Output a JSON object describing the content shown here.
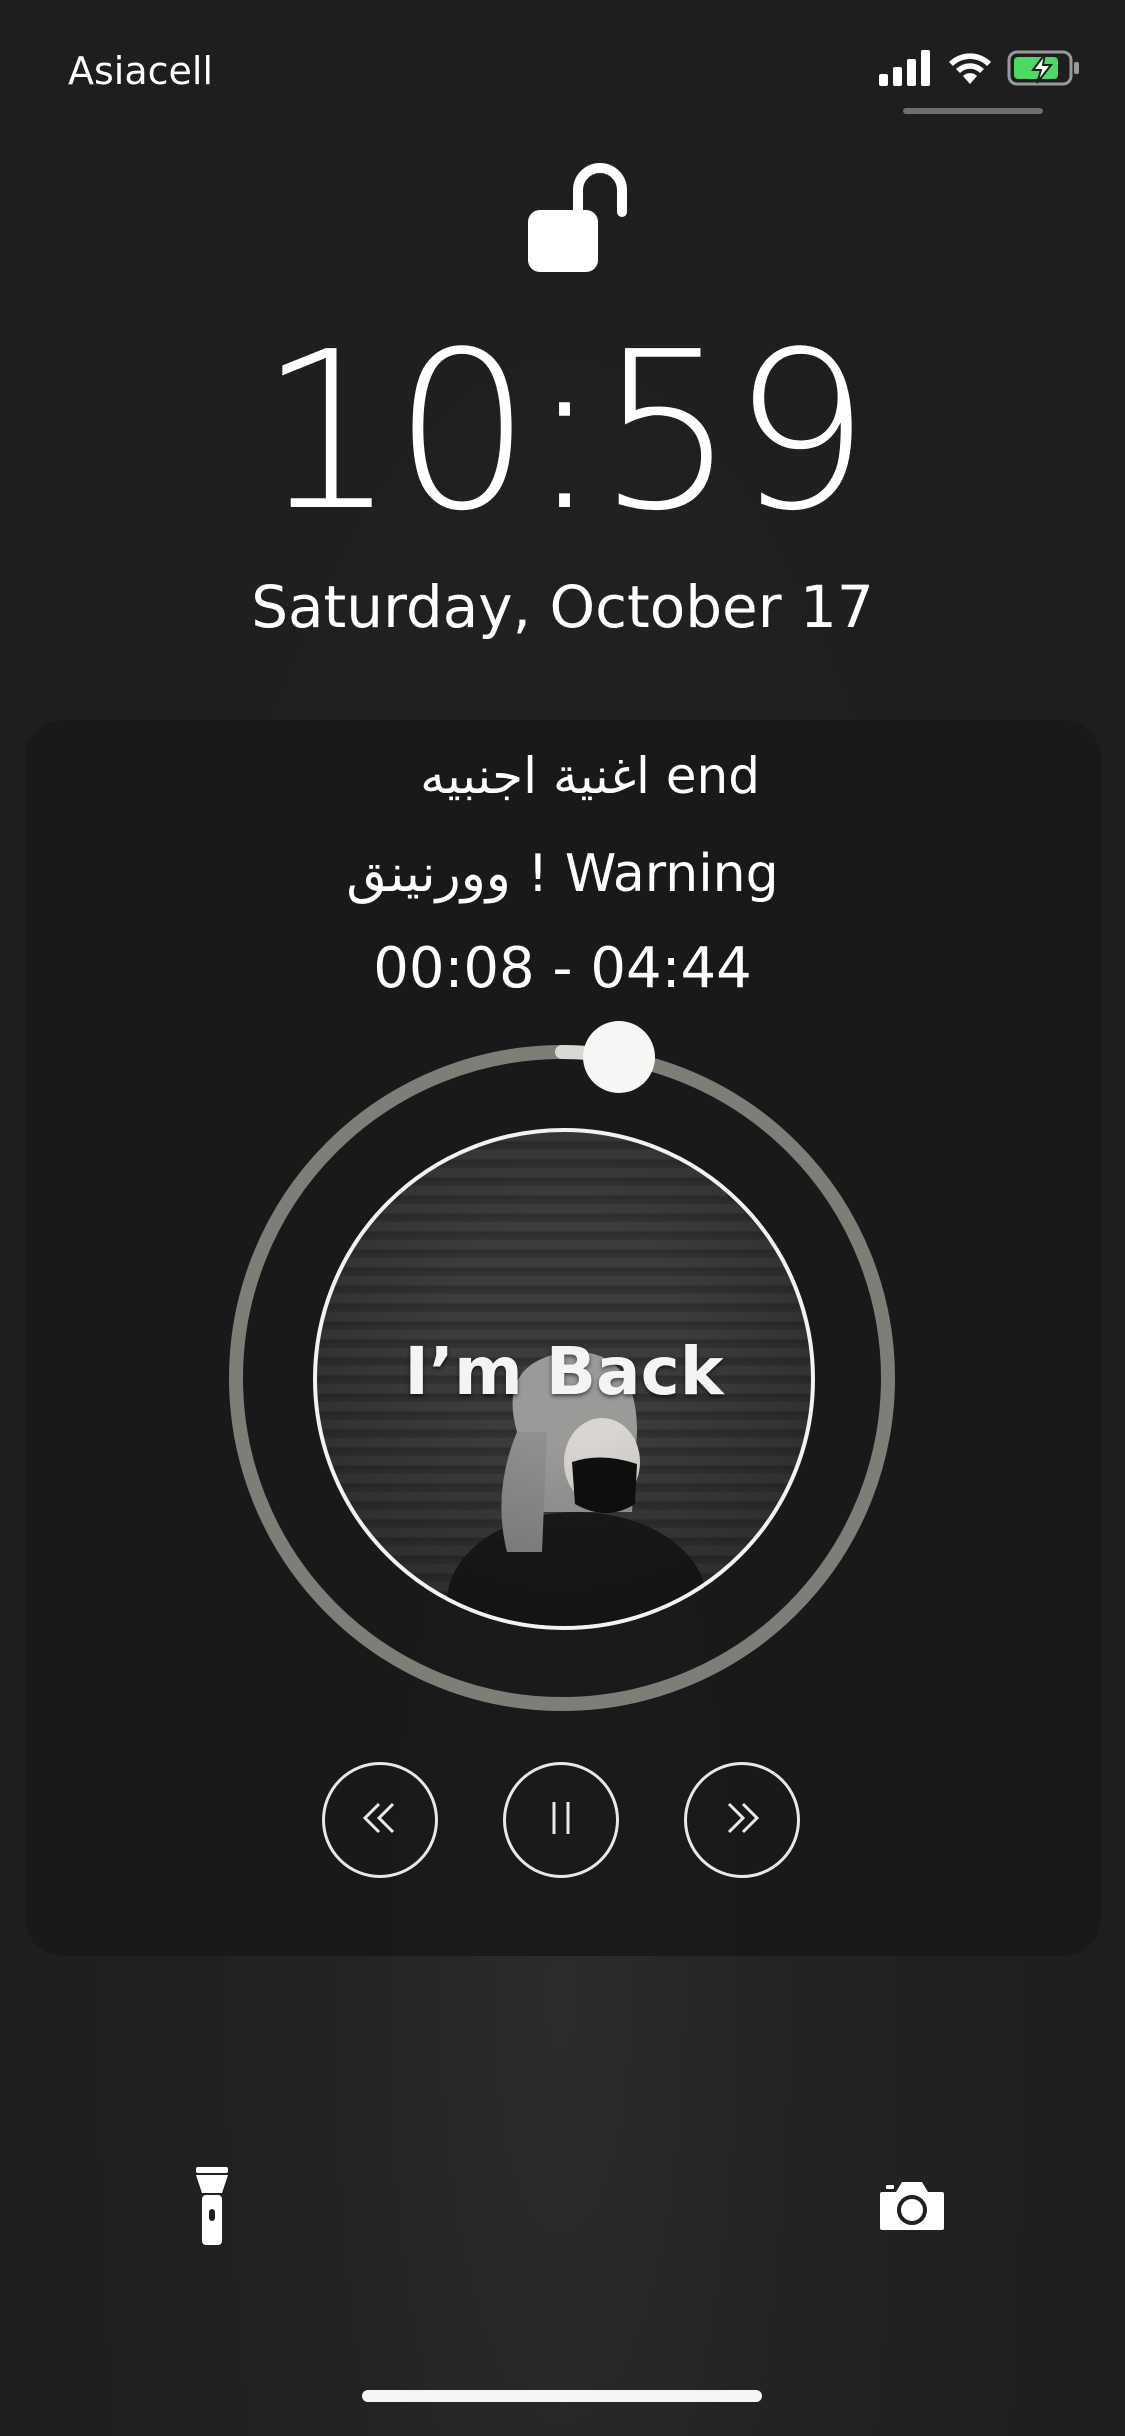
{
  "status_bar": {
    "carrier": "Asiacell",
    "icons": [
      "cellular-signal-icon",
      "wifi-icon",
      "battery-charging-icon"
    ],
    "battery_color": "#4cd964"
  },
  "lock_screen": {
    "lock_icon": "unlocked-padlock-icon",
    "time": "10:59",
    "date": "Saturday, October 17"
  },
  "now_playing": {
    "title": "اغنية اجنبيه end",
    "artist": "وورنينق ! Warning",
    "time_display": "00:08 - 04:44",
    "elapsed_seconds": 8,
    "duration_seconds": 284,
    "artwork_text": "I’m Back",
    "controls": {
      "previous_icon": "rewind-icon",
      "pause_icon": "pause-icon",
      "next_icon": "fast-forward-icon"
    },
    "colors": {
      "ring_track": "#7e7e79",
      "ring_progress": "#d8d8d4",
      "knob": "#f6f6f4"
    }
  },
  "quick_actions": {
    "left_icon": "flashlight-icon",
    "right_icon": "camera-icon"
  }
}
